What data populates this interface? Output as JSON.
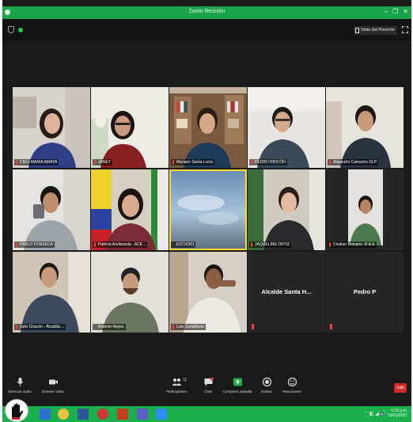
{
  "window": {
    "title": "Zoom Reunión",
    "controls": [
      "–",
      "❐",
      "✕"
    ]
  },
  "topbar": {
    "view_label": "Vista del Ponente"
  },
  "participants": [
    {
      "name": "CIELI MARIA AMAYA",
      "mic_muted": true
    },
    {
      "name": "JANET",
      "mic_muted": true
    },
    {
      "name": "Mariano Santa Lucía",
      "mic_muted": true
    },
    {
      "name": "PEDRO RINCÓN",
      "mic_muted": true
    },
    {
      "name": "Alejandro Camacho DLP",
      "mic_muted": true
    },
    {
      "name": "PABLO FONSECA",
      "mic_muted": true
    },
    {
      "name": "Patricia Arellaneda - ACE...",
      "mic_muted": true
    },
    {
      "name": "ESTUDIO",
      "mic_muted": false
    },
    {
      "name": "JAQUELINE ORTIZ",
      "mic_muted": true
    },
    {
      "name": "Cristian Toscano .R.A.E",
      "mic_muted": true
    },
    {
      "name": "Julio Chacón - Alcaldía ...",
      "mic_muted": true
    },
    {
      "name": "Antonio Reyes",
      "mic_muted": false
    },
    {
      "name": "Luis Castañeda",
      "mic_muted": true
    },
    {
      "name": "Alcalde Santa H...",
      "mic_muted": true
    },
    {
      "name": "Pedro P",
      "mic_muted": true
    }
  ],
  "toolbar": {
    "unmute_label": "Silenciar audio",
    "video_label": "Detener video",
    "participants_label": "Participantes",
    "participants_count": "11",
    "chat_label": "Chat",
    "share_label": "Compartir pantalla",
    "record_label": "Grabar",
    "reactions_label": "Reacciones",
    "leave_label": "Salir"
  },
  "taskbar": {
    "time": "4:15 p.m.",
    "date": "15/01/2021",
    "tray": "⌃ ◧ ◢ 🔊"
  },
  "colors": {
    "accent": "#1aa34a",
    "active_speaker": "#ffd92e",
    "muted": "#ff3b3b",
    "leave": "#d42a2a"
  }
}
